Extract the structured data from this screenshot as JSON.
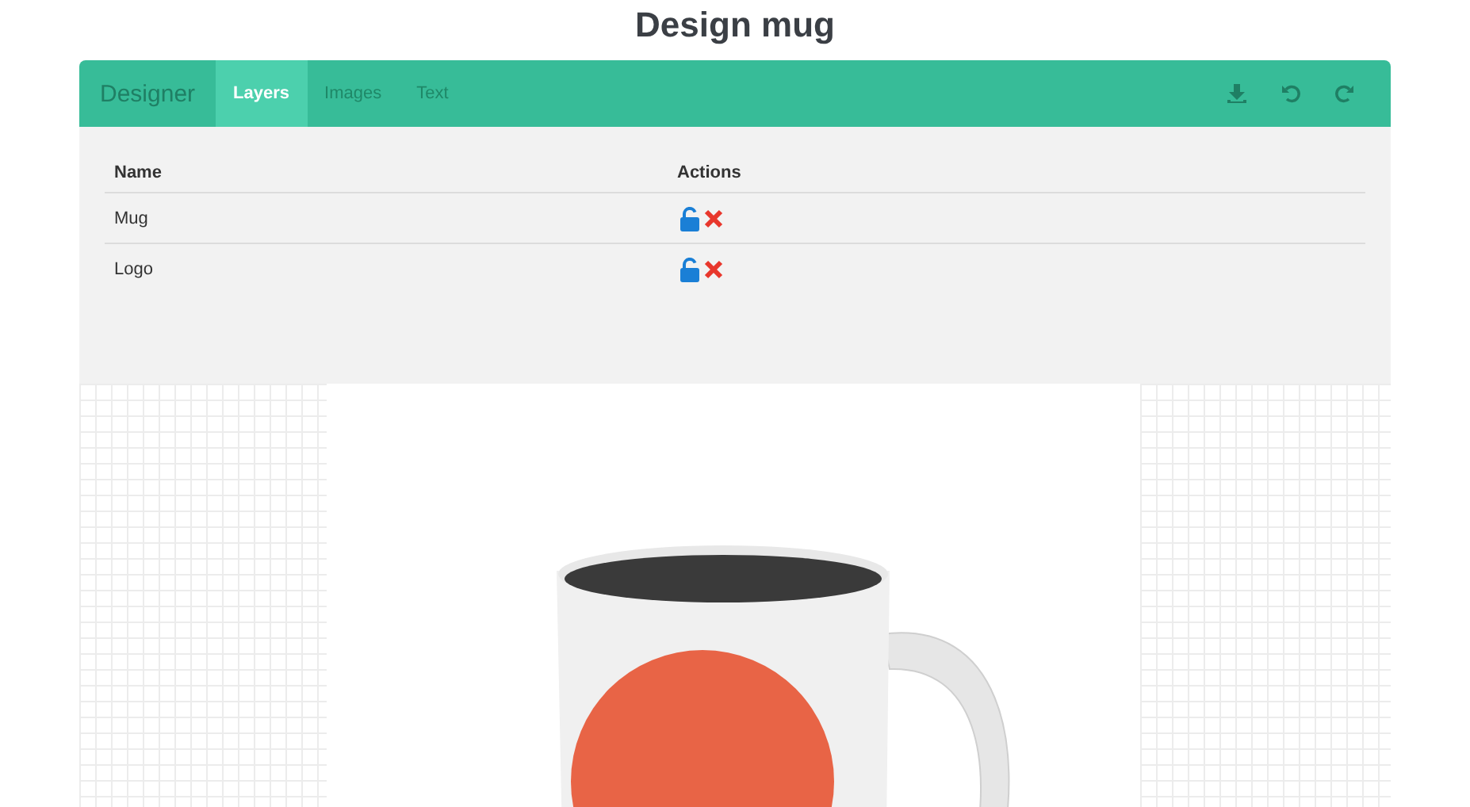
{
  "page_title": "Design mug",
  "toolbar": {
    "brand": "Designer",
    "tabs": [
      {
        "label": "Layers",
        "selected": true
      },
      {
        "label": "Images",
        "selected": false
      },
      {
        "label": "Text",
        "selected": false
      }
    ]
  },
  "layers": {
    "columns": [
      "Name",
      "Actions"
    ],
    "rows": [
      {
        "name": "Mug",
        "locked": false
      },
      {
        "name": "Logo",
        "locked": false
      }
    ]
  }
}
